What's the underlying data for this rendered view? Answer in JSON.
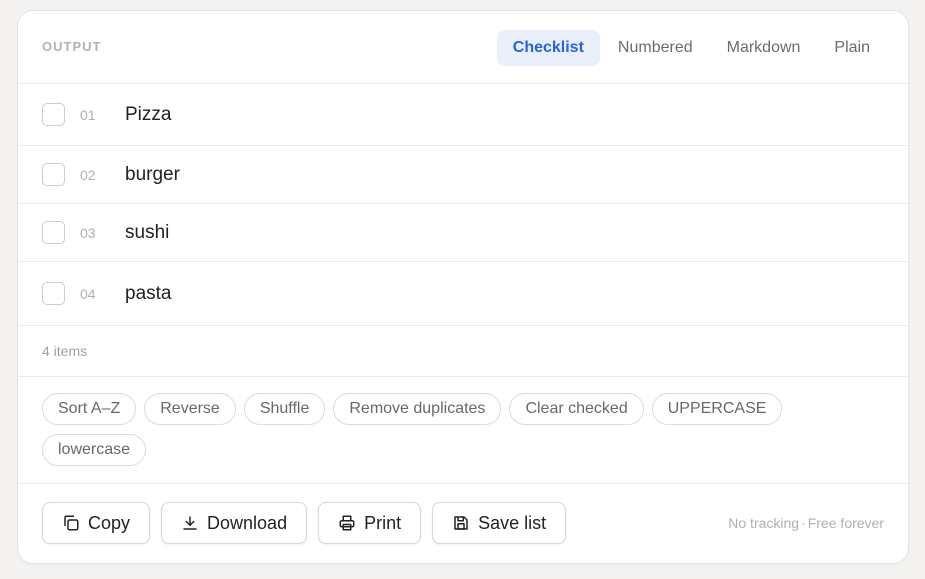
{
  "header": {
    "output_label": "OUTPUT",
    "tabs": [
      {
        "label": "Checklist",
        "active": true
      },
      {
        "label": "Numbered",
        "active": false
      },
      {
        "label": "Markdown",
        "active": false
      },
      {
        "label": "Plain",
        "active": false
      }
    ]
  },
  "list": {
    "items": [
      {
        "num": "01",
        "text": "Pizza",
        "checked": false
      },
      {
        "num": "02",
        "text": "burger",
        "checked": false
      },
      {
        "num": "03",
        "text": "sushi",
        "checked": false
      },
      {
        "num": "04",
        "text": "pasta",
        "checked": false
      }
    ]
  },
  "count_label": "4 items",
  "actions": [
    "Sort A–Z",
    "Reverse",
    "Shuffle",
    "Remove duplicates",
    "Clear checked",
    "UPPERCASE",
    "lowercase"
  ],
  "footer": {
    "buttons": [
      {
        "label": "Copy",
        "icon": "copy-icon"
      },
      {
        "label": "Download",
        "icon": "download-icon"
      },
      {
        "label": "Print",
        "icon": "print-icon"
      },
      {
        "label": "Save list",
        "icon": "save-icon"
      }
    ],
    "note_left": "No tracking",
    "note_sep": "·",
    "note_right": "Free forever"
  },
  "colors": {
    "accent": "#2b63d9",
    "accent_bg": "#e8effb",
    "page_bg": "#f4f3f1"
  }
}
